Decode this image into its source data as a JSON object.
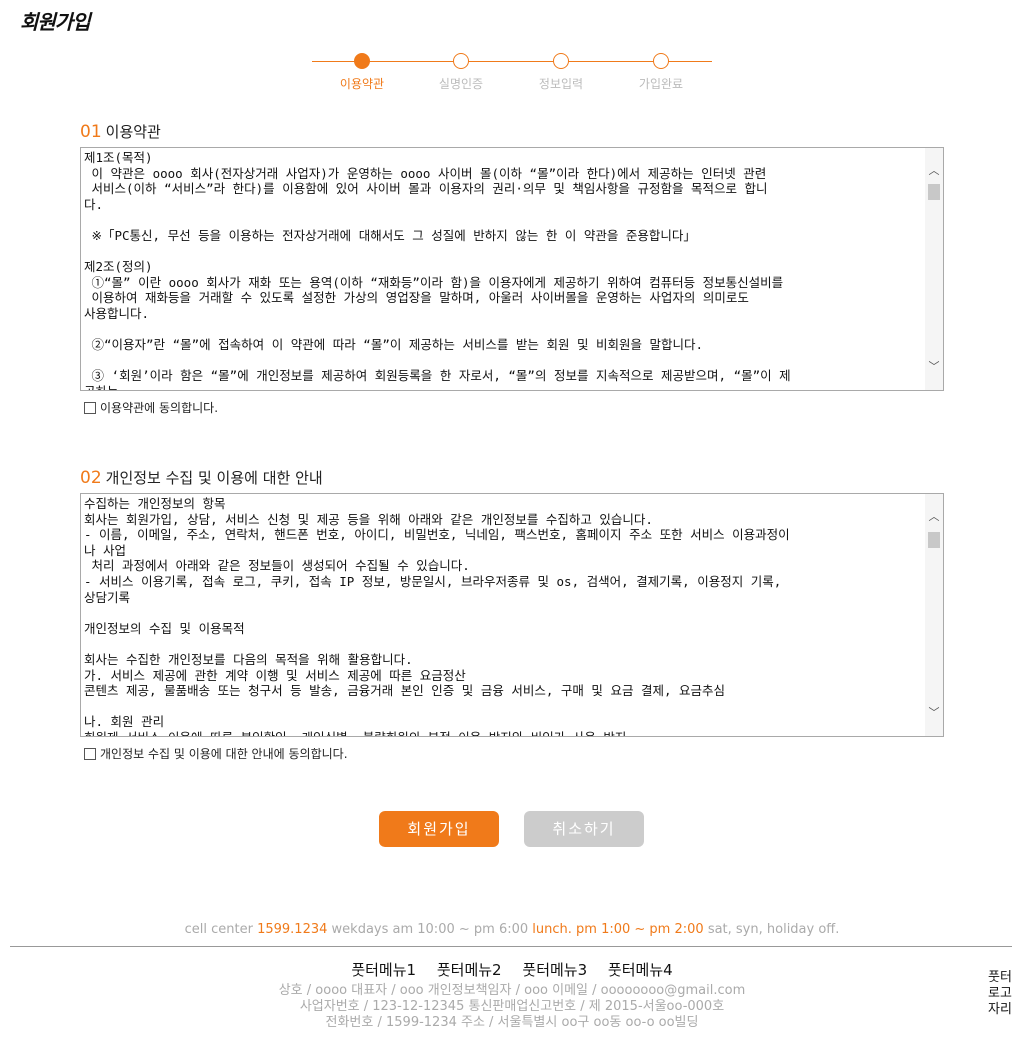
{
  "header": {
    "logo_text": "회원가입"
  },
  "steps": [
    {
      "label": "이용약관",
      "active": true
    },
    {
      "label": "실명인증",
      "active": false
    },
    {
      "label": "정보입력",
      "active": false
    },
    {
      "label": "가입완료",
      "active": false
    }
  ],
  "terms": {
    "number": "01",
    "title": "이용약관",
    "text": "제1조(목적)\n 이 약관은 oooo 회사(전자상거래 사업자)가 운영하는 oooo 사이버 몰(이하 “몰”이라 한다)에서 제공하는 인터넷 관련\n 서비스(이하 “서비스”라 한다)를 이용함에 있어 사이버 몰과 이용자의 권리·의무 및 책임사항을 규정함을 목적으로 합니\n다.\n\n ※「PC통신, 무선 등을 이용하는 전자상거래에 대해서도 그 성질에 반하지 않는 한 이 약관을 준용합니다」\n\n제2조(정의)\n ①“몰” 이란 oooo 회사가 재화 또는 용역(이하 “재화등”이라 함)을 이용자에게 제공하기 위하여 컴퓨터등 정보통신설비를\n 이용하여 재화등을 거래할 수 있도록 설정한 가상의 영업장을 말하며, 아울러 사이버몰을 운영하는 사업자의 의미로도\n사용합니다.\n\n ②“이용자”란 “몰”에 접속하여 이 약관에 따라 “몰”이 제공하는 서비스를 받는 회원 및 비회원을 말합니다.\n\n ③ ‘회원’이라 함은 “몰”에 개인정보를 제공하여 회원등록을 한 자로서, “몰”의 정보를 지속적으로 제공받으며, “몰”이 제\n공하는",
    "agree_label": "이용약관에 동의합니다."
  },
  "privacy": {
    "number": "02",
    "title": "개인정보 수집 및 이용에 대한 안내",
    "text": "수집하는 개인정보의 항목\n회사는 회원가입, 상담, 서비스 신청 및 제공 등을 위해 아래와 같은 개인정보를 수집하고 있습니다.\n- 이름, 이메일, 주소, 연락처, 핸드폰 번호, 아이디, 비밀번호, 닉네임, 팩스번호, 홈페이지 주소 또한 서비스 이용과정이\n나 사업\n 처리 과정에서 아래와 같은 정보들이 생성되어 수집될 수 있습니다.\n- 서비스 이용기록, 접속 로그, 쿠키, 접속 IP 정보, 방문일시, 브라우저종류 및 os, 검색어, 결제기록, 이용정지 기록,\n상담기록\n\n개인정보의 수집 및 이용목적\n\n회사는 수집한 개인정보를 다음의 목적을 위해 활용합니다.\n가. 서비스 제공에 관한 계약 이행 및 서비스 제공에 따른 요금정산\n콘텐츠 제공, 물품배송 또는 청구서 등 발송, 금융거래 본인 인증 및 금융 서비스, 구매 및 요금 결제, 요금추심\n\n나. 회원 관리\n회원제 서비스 이용에 따른 본인확인, 개인식별, 불량회원의 부정 이용 방지와 비인가 사용 방지",
    "agree_label": "개인정보 수집 및 이용에 대한 안내에 동의합니다."
  },
  "buttons": {
    "join": "회원가입",
    "cancel": "취소하기"
  },
  "footer": {
    "cc_prefix": "cell center",
    "cc_phone": "1599.1234",
    "cc_hours": "wekdays am 10:00 ~ pm 6:00",
    "cc_lunch": "lunch. pm 1:00 ~ pm 2:00",
    "cc_off": "sat, syn, holiday off.",
    "menu": [
      "풋터메뉴1",
      "풋터메뉴2",
      "풋터메뉴3",
      "풋터메뉴4"
    ],
    "info_line1": "상호 / oooo   대표자 / ooo   개인정보책임자 / ooo   이메일 / oooooooo@gmail.com",
    "info_line2": "사업자번호 / 123-12-12345   통신판매업신고번호 / 제 2015-서울oo-000호",
    "info_line3": "전화번호 / 1599-1234   주소 / 서울특별시 oo구 oo동 oo-o oo빌딩",
    "logo_lines": [
      "풋터",
      "로고",
      "자리"
    ]
  },
  "colors": {
    "accent": "#f07a1a",
    "cancel": "#cccccc"
  }
}
